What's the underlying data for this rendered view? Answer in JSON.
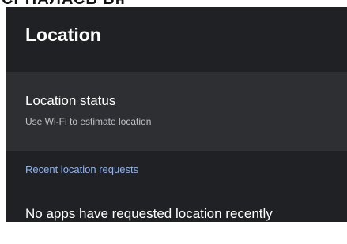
{
  "top_strip": {
    "text": "СРНАЛАСЬ Вн"
  },
  "header": {
    "title": "Location"
  },
  "location_status": {
    "title": "Location status",
    "subtitle": "Use Wi-Fi to estimate location"
  },
  "recent_requests": {
    "header": "Recent location requests",
    "empty_message": "No apps have requested location recently"
  },
  "colors": {
    "panel_background": "#202124",
    "selected_row_background": "#2e2f32",
    "accent": "#8ab4f8",
    "primary_text": "#ffffff",
    "secondary_text": "#bdc1c6"
  }
}
